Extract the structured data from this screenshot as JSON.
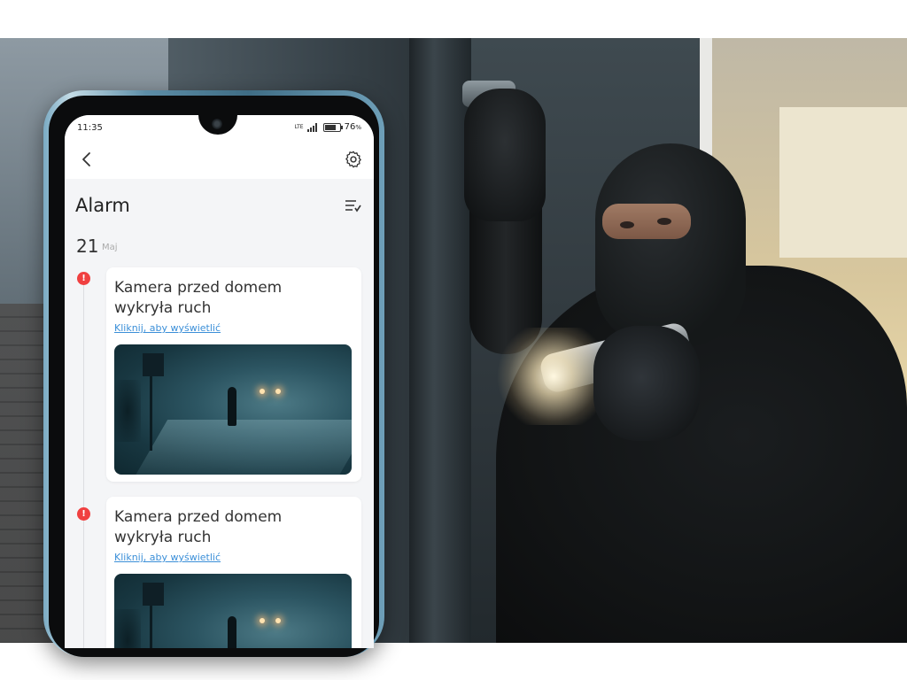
{
  "status_bar": {
    "time": "11:35",
    "network": "LTE",
    "battery_percent": "76",
    "battery_unit": "%",
    "battery_level": 0.76
  },
  "app_bar": {
    "back_icon": "chevron-left-icon",
    "settings_icon": "gear-icon"
  },
  "page": {
    "title": "Alarm",
    "filter_icon": "checklist-icon"
  },
  "date_group": {
    "day": "21",
    "month": "Maj"
  },
  "notifications": [
    {
      "message": "Kamera przed domem wykryła ruch",
      "link": "Kliknij, aby wyświetlić",
      "alert_icon": "exclamation-icon"
    },
    {
      "message": "Kamera przed domem wykryła ruch",
      "link": "Kliknij, aby wyświetlić",
      "alert_icon": "exclamation-icon"
    }
  ],
  "colors": {
    "alert": "#f04040",
    "link": "#3b8fd8"
  }
}
